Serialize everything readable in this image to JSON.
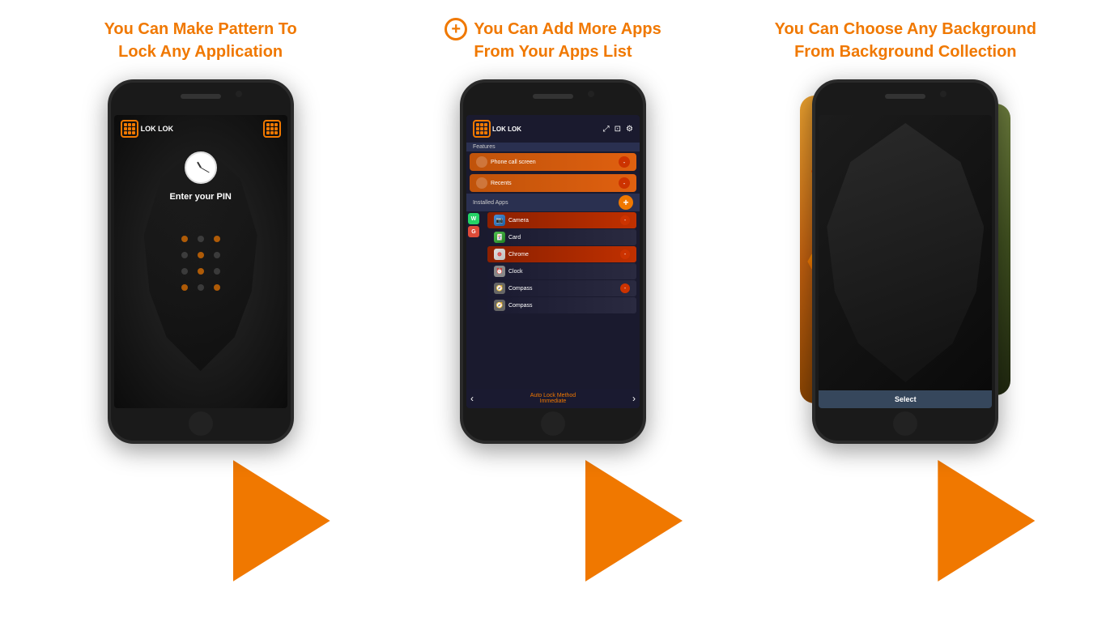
{
  "panel1": {
    "title_line1": "You Can Make Pattern To",
    "title_line2": "Lock Any Application"
  },
  "panel2": {
    "title_line1": "You Can Add More Apps",
    "title_line2": "From Your Apps List"
  },
  "panel3": {
    "title_line1": "You Can Choose Any Background",
    "title_line2": "From Background Collection"
  },
  "phone1": {
    "app_name": "LOK LOK",
    "pin_text": "Enter your PIN"
  },
  "phone2": {
    "app_name": "LOK LOK",
    "features_label": "Features",
    "feature1": "Phone call screen",
    "feature2": "Recents",
    "installed_label": "Installed Apps",
    "apps": [
      "Camera",
      "Card",
      "Chrome",
      "Clock",
      "Compass",
      "Compass"
    ],
    "lock_method_label": "Auto Lock Method",
    "lock_method_value": "Immediate"
  },
  "phone3": {
    "select_label": "Select"
  }
}
